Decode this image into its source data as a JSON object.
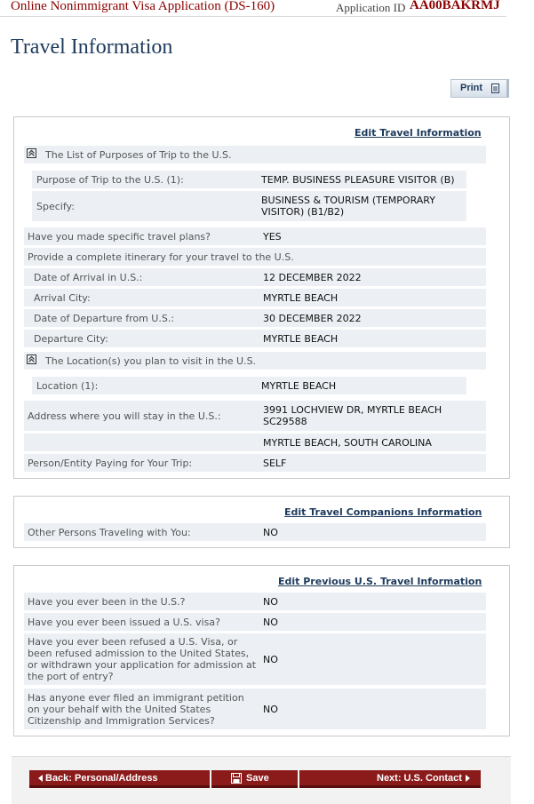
{
  "header": {
    "app_title": "Online Nonimmigrant Visa Application (DS-160)",
    "app_id_label": "Application ID",
    "app_id": "AA00BAKRMJ"
  },
  "page_title": "Travel Information",
  "print_label": "Print",
  "travel": {
    "edit_label": "Edit Travel Information",
    "purposes_heading": "The List of Purposes of Trip to the U.S.",
    "purpose_label": "Purpose of Trip to the U.S. (1):",
    "purpose_value": "TEMP. BUSINESS PLEASURE VISITOR (B)",
    "specify_label": "Specify:",
    "specify_value_line1": "BUSINESS & TOURISM (TEMPORARY",
    "specify_value_line2": "VISITOR) (B1/B2)",
    "plans_label": "Have you made specific travel plans?",
    "plans_value": "YES",
    "itinerary_label": "Provide a complete itinerary for your travel to the U.S.",
    "arrival_date_label": "Date of Arrival in U.S.:",
    "arrival_date_value": "12 DECEMBER 2022",
    "arrival_city_label": "Arrival City:",
    "arrival_city_value": "MYRTLE BEACH",
    "departure_date_label": "Date of Departure from U.S.:",
    "departure_date_value": "30 DECEMBER 2022",
    "departure_city_label": "Departure City:",
    "departure_city_value": "MYRTLE BEACH",
    "locations_heading": "The Location(s) you plan to visit in the U.S.",
    "location_label": "Location (1):",
    "location_value": "MYRTLE BEACH",
    "address_label": "Address where you will stay in the U.S.:",
    "address_line1": "3991 LOCHVIEW DR, MYRTLE BEACH",
    "address_line2": "SC29588",
    "address_line3": "MYRTLE BEACH, SOUTH CAROLINA",
    "payer_label": "Person/Entity Paying for Your Trip:",
    "payer_value": "SELF"
  },
  "companions": {
    "edit_label": "Edit Travel Companions Information",
    "others_label": "Other Persons Traveling with You:",
    "others_value": "NO"
  },
  "previous": {
    "edit_label": "Edit Previous U.S. Travel Information",
    "been_label": "Have you ever been in the U.S.?",
    "been_value": "NO",
    "visa_label": "Have you ever been issued a U.S. visa?",
    "visa_value": "NO",
    "refused_line1": "Have you ever been refused a U.S. Visa, or",
    "refused_line2": "been refused admission to the United States,",
    "refused_line3": "or withdrawn your application for admission at",
    "refused_line4": "the port of entry?",
    "refused_value": "NO",
    "petition_line1": "Has anyone ever filed an immigrant petition",
    "petition_line2": "on your behalf with the United States",
    "petition_line3": "Citizenship and Immigration Services?",
    "petition_value": "NO"
  },
  "nav": {
    "back_label": "Back: Personal/Address",
    "save_label": "Save",
    "next_label": "Next: U.S. Contact"
  },
  "colors": {
    "brand_red": "#8b0000",
    "nav_button": "#8b1a1a",
    "title_blue": "#1d3a5c",
    "row_bg": "#ecf0f5"
  }
}
